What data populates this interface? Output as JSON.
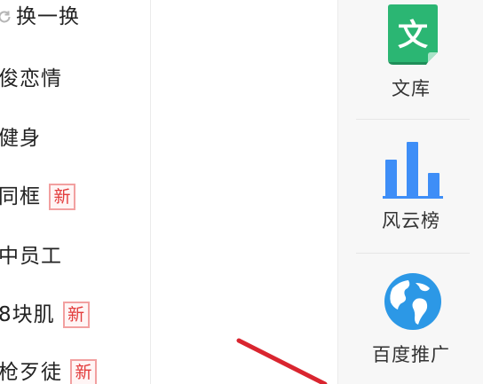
{
  "left_list": {
    "refresh_label": "换一换",
    "items": [
      {
        "label": "俊恋情",
        "badge": ""
      },
      {
        "label": "健身",
        "badge": ""
      },
      {
        "label": "同框",
        "badge": "新"
      },
      {
        "label": "中员工",
        "badge": ""
      },
      {
        "label": "8块肌",
        "badge": "新"
      },
      {
        "label": "枪歹徒",
        "badge": "新"
      }
    ]
  },
  "right_panel": {
    "apps": [
      {
        "label": "文库",
        "icon": "wenku-document-icon",
        "color": "#2bb673"
      },
      {
        "label": "风云榜",
        "icon": "bar-chart-icon",
        "color": "#3e8ef7"
      },
      {
        "label": "百度推广",
        "icon": "globe-icon",
        "color": "#2c98e6"
      }
    ]
  },
  "colors": {
    "new_badge": "#e23b3b",
    "annotation_arrow": "#d9252f"
  }
}
